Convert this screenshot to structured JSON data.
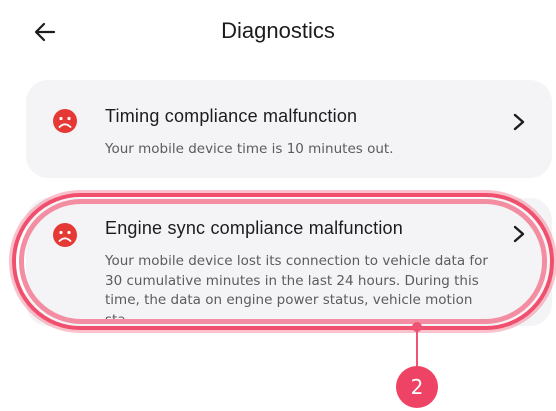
{
  "header": {
    "title": "Diagnostics",
    "back_icon": "arrow-left-icon"
  },
  "diagnostics": [
    {
      "title": "Timing compliance malfunction",
      "description": "Your mobile device time is 10 minutes out.",
      "status_icon": "sad-face-icon",
      "status_color": "#e53935"
    },
    {
      "title": "Engine sync compliance malfunction",
      "description": "Your mobile device lost its connection to vehicle data for 30 cumulative minutes in the last 24 hours. During this time, the data on engine power status, vehicle motion sta...",
      "status_icon": "sad-face-icon",
      "status_color": "#e53935"
    }
  ],
  "annotation": {
    "step_number": "2",
    "highlight_color": "#ef4365"
  }
}
